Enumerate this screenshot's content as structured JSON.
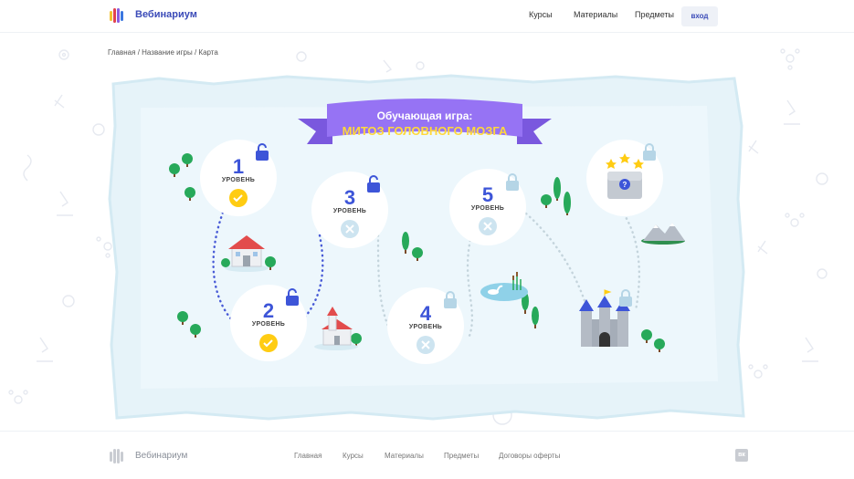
{
  "header": {
    "brand": "Вебинариум",
    "nav": [
      "Курсы",
      "Материалы",
      "Предметы"
    ],
    "login_label": "вход"
  },
  "breadcrumb": {
    "items": [
      "Главная",
      "Название игры",
      "Карта"
    ],
    "separator": "/"
  },
  "map": {
    "title_line1": "Обучающая игра:",
    "title_line2": "МИТОЗ ГОЛОВНОГО МОЗГА",
    "level_word": "УРОВЕНЬ",
    "levels": [
      {
        "number": "1",
        "status": "completed",
        "lock": "open"
      },
      {
        "number": "2",
        "status": "completed",
        "lock": "open"
      },
      {
        "number": "3",
        "status": "not-completed",
        "lock": "open"
      },
      {
        "number": "4",
        "status": "not-completed",
        "lock": "locked"
      },
      {
        "number": "5",
        "status": "not-completed",
        "lock": "locked"
      }
    ],
    "reward": {
      "icon": "treasure-chest-icon",
      "stars": 3,
      "lock": "locked"
    },
    "colors": {
      "map": "#dff1f8",
      "accent": "#3d55d8",
      "check": "#ffcc12",
      "ribbon": "#8c6cf0",
      "ribbon_text": "#ffd83a"
    }
  },
  "footer": {
    "brand": "Вебинариум",
    "nav": [
      "Главная",
      "Курсы",
      "Материалы",
      "Предметы",
      "Договоры оферты"
    ],
    "social": "вк"
  }
}
